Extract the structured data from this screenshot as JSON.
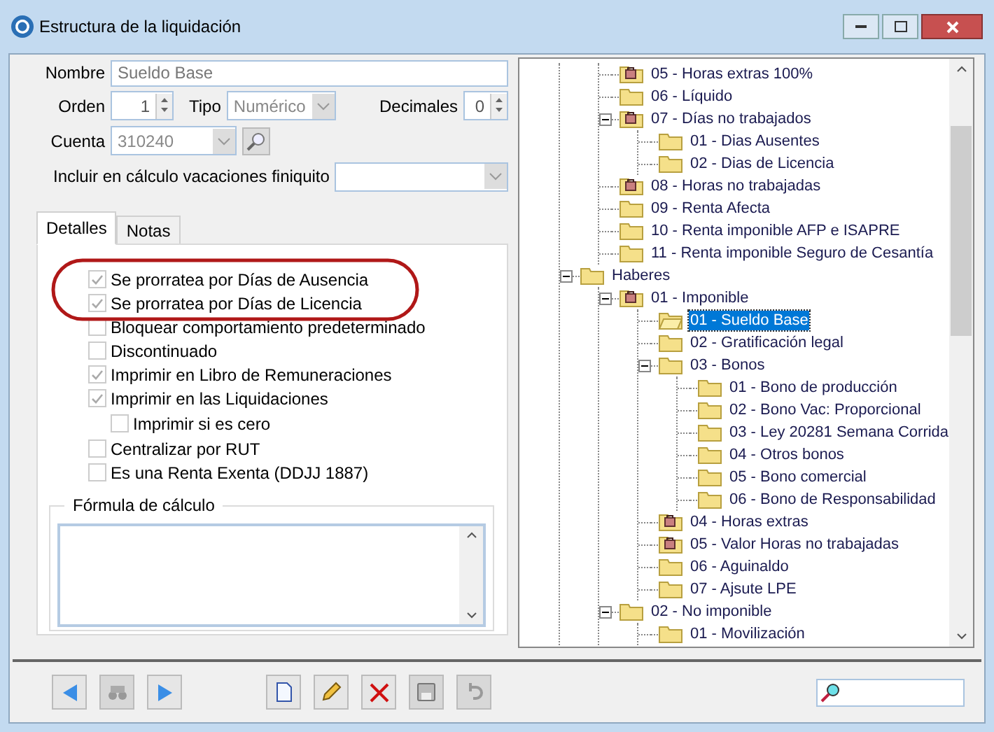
{
  "window": {
    "title": "Estructura de la liquidación"
  },
  "form": {
    "nombre": {
      "label": "Nombre",
      "value": "Sueldo Base"
    },
    "orden": {
      "label": "Orden",
      "value": "1"
    },
    "tipo": {
      "label": "Tipo",
      "value": "Numérico"
    },
    "decimales": {
      "label": "Decimales",
      "value": "0"
    },
    "cuenta": {
      "label": "Cuenta",
      "value": "310240"
    },
    "vacaciones": {
      "label": "Incluir en cálculo vacaciones finiquito"
    }
  },
  "tabs": [
    {
      "label": "Detalles",
      "selected": true
    },
    {
      "label": "Notas",
      "selected": false
    }
  ],
  "checkboxes": [
    {
      "label": "Se prorratea por Días de Ausencia",
      "checked": true,
      "indented": false
    },
    {
      "label": "Se prorratea por Días de Licencia",
      "checked": true,
      "indented": false
    },
    {
      "label": "Bloquear comportamiento predeterminado",
      "checked": false,
      "indented": false
    },
    {
      "label": "Discontinuado",
      "checked": false,
      "indented": false
    },
    {
      "label": "Imprimir en Libro de Remuneraciones",
      "checked": true,
      "indented": false
    },
    {
      "label": "Imprimir en las Liquidaciones",
      "checked": true,
      "indented": false
    },
    {
      "label": "Imprimir si es cero",
      "checked": false,
      "indented": true
    },
    {
      "label": "Centralizar por RUT",
      "checked": false,
      "indented": false
    },
    {
      "label": "Es una Renta Exenta (DDJJ 1887)",
      "checked": false,
      "indented": false
    }
  ],
  "formula": {
    "label": "Fórmula de cálculo"
  },
  "tree": [
    {
      "children": [
        {
          "children": [
            {
              "label": "05 - Horas extras 100%",
              "kind": "locked",
              "selected": false
            },
            {
              "label": "06 - Líquido",
              "kind": "folder",
              "selected": false
            },
            {
              "label": "07 - Días no trabajados",
              "kind": "locked",
              "selected": false,
              "expanded": true,
              "children": [
                {
                  "label": "01 - Dias Ausentes",
                  "kind": "folder",
                  "selected": false
                },
                {
                  "label": "02 - Dias de Licencia",
                  "kind": "folder",
                  "selected": false
                }
              ]
            },
            {
              "label": "08 - Horas no trabajadas",
              "kind": "locked",
              "selected": false
            },
            {
              "label": "09 - Renta Afecta",
              "kind": "folder",
              "selected": false
            },
            {
              "label": "10 - Renta imponible AFP e ISAPRE",
              "kind": "folder",
              "selected": false
            },
            {
              "label": "11 - Renta imponible Seguro de Cesantía",
              "kind": "folder",
              "selected": false
            }
          ]
        },
        {
          "label": "Haberes",
          "kind": "folder",
          "selected": false,
          "expanded": true,
          "children": [
            {
              "label": "01 - Imponible",
              "kind": "locked",
              "selected": false,
              "expanded": true,
              "children": [
                {
                  "label": "01 - Sueldo Base",
                  "kind": "folder",
                  "selected": true
                },
                {
                  "label": "02 - Gratificación legal",
                  "kind": "folder",
                  "selected": false
                },
                {
                  "label": "03 - Bonos",
                  "kind": "folder",
                  "selected": false,
                  "expanded": true,
                  "children": [
                    {
                      "label": "01 - Bono de producción",
                      "kind": "folder",
                      "selected": false
                    },
                    {
                      "label": "02 - Bono Vac: Proporcional",
                      "kind": "folder",
                      "selected": false
                    },
                    {
                      "label": "03 - Ley 20281 Semana Corrida",
                      "kind": "folder",
                      "selected": false
                    },
                    {
                      "label": "04 - Otros bonos",
                      "kind": "folder",
                      "selected": false
                    },
                    {
                      "label": "05 - Bono comercial",
                      "kind": "folder",
                      "selected": false
                    },
                    {
                      "label": "06 - Bono de Responsabilidad",
                      "kind": "folder",
                      "selected": false
                    }
                  ]
                },
                {
                  "label": "04 - Horas extras",
                  "kind": "locked",
                  "selected": false
                },
                {
                  "label": "05 - Valor Horas no trabajadas",
                  "kind": "locked",
                  "selected": false
                },
                {
                  "label": "06 - Aguinaldo",
                  "kind": "folder",
                  "selected": false
                },
                {
                  "label": "07 - Ajsute LPE",
                  "kind": "folder",
                  "selected": false
                }
              ]
            },
            {
              "label": "02 - No imponible",
              "kind": "folder",
              "selected": false,
              "expanded": true,
              "children": [
                {
                  "label": "01 - Movilización",
                  "kind": "folder",
                  "selected": false
                }
              ]
            }
          ]
        }
      ]
    }
  ]
}
